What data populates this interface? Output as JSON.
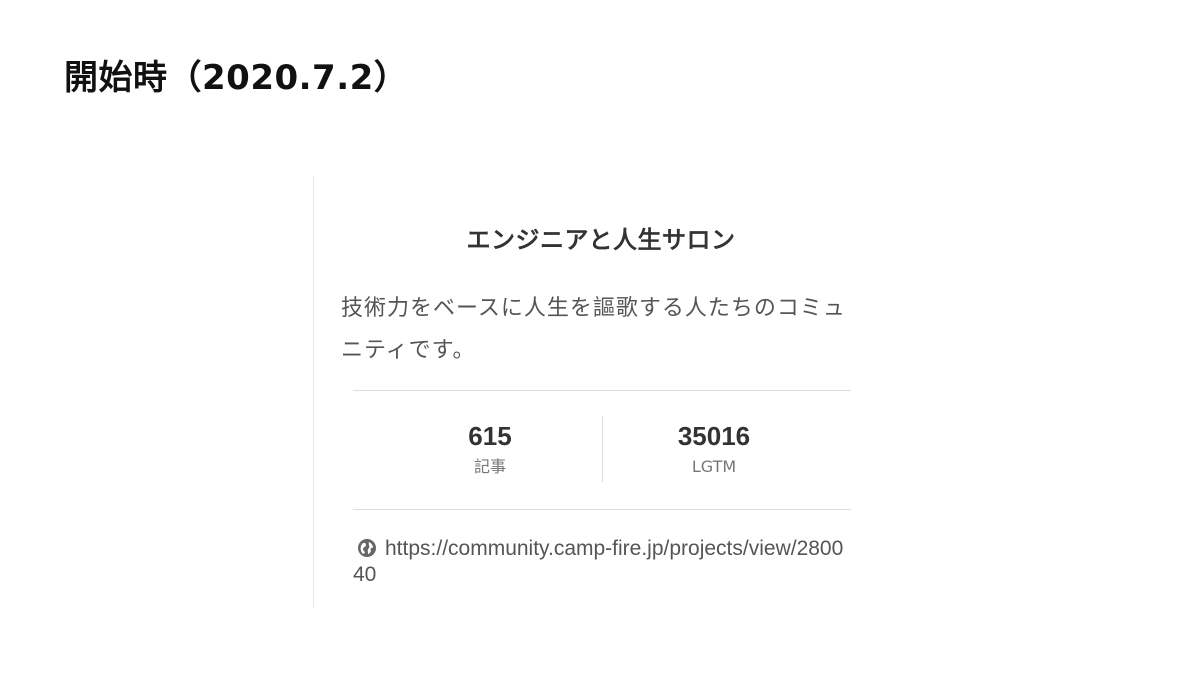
{
  "slide": {
    "title": "開始時（2020.7.2）"
  },
  "card": {
    "title": "エンジニアと人生サロン",
    "description": "技術力をベースに人生を謳歌する人たちのコミュニティです。",
    "stats": {
      "articles": {
        "value": "615",
        "label": "記事"
      },
      "lgtm": {
        "value": "35016",
        "label": "LGTM"
      }
    },
    "link": {
      "icon": "globe-icon",
      "url": "https://community.camp-fire.jp/projects/view/280040"
    }
  },
  "colors": {
    "title_text": "#111111",
    "card_text": "#333333",
    "muted_text": "#555555",
    "divider": "#dddddd"
  }
}
